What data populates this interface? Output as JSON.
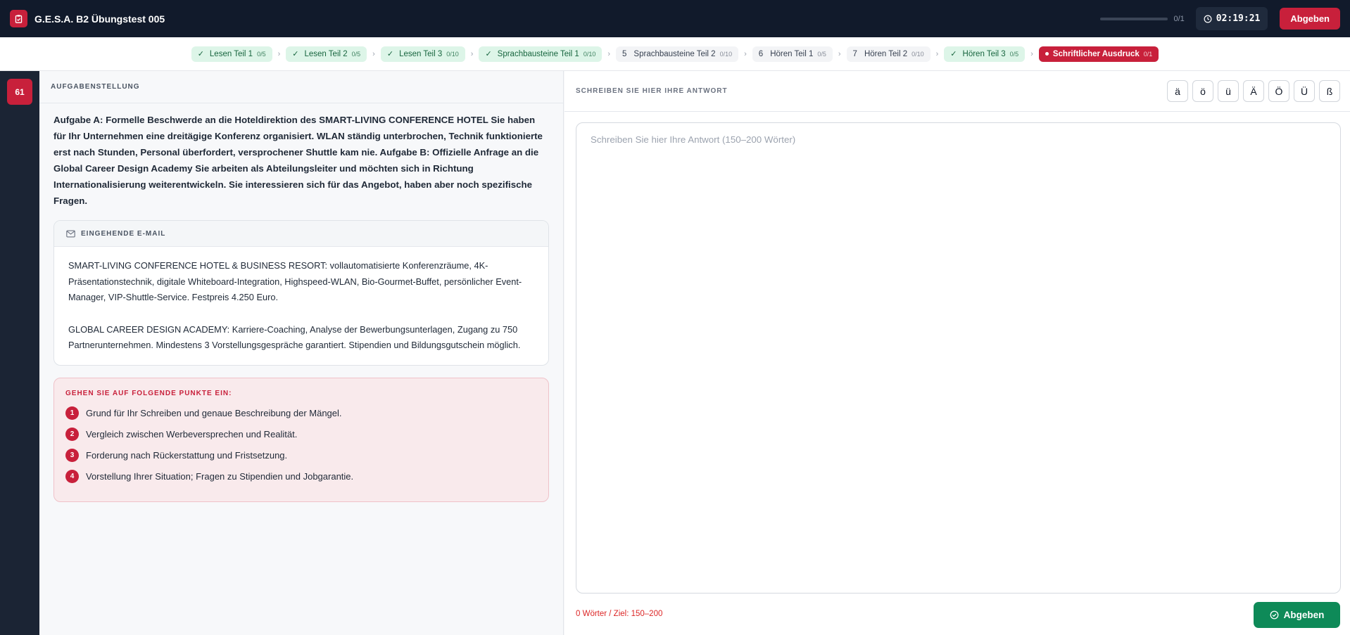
{
  "header": {
    "title": "G.E.S.A. B2 Übungstest 005",
    "progress_count": "0/1",
    "progress_fraction": 0.0,
    "timer": "02:19:21",
    "submit_label": "Abgeben"
  },
  "steps": [
    {
      "label": "Lesen Teil 1",
      "count": "0/5",
      "state": "done"
    },
    {
      "label": "Lesen Teil 2",
      "count": "0/5",
      "state": "done"
    },
    {
      "label": "Lesen Teil 3",
      "count": "0/10",
      "state": "done"
    },
    {
      "label": "Sprachbausteine Teil 1",
      "count": "0/10",
      "state": "done"
    },
    {
      "number": "5",
      "label": "Sprachbausteine Teil 2",
      "count": "0/10",
      "state": "pending"
    },
    {
      "number": "6",
      "label": "Hören Teil 1",
      "count": "0/5",
      "state": "pending"
    },
    {
      "number": "7",
      "label": "Hören Teil 2",
      "count": "0/10",
      "state": "pending"
    },
    {
      "label": "Hören Teil 3",
      "count": "0/5",
      "state": "done"
    },
    {
      "label": "Schriftlicher Ausdruck",
      "count": "0/1",
      "state": "active"
    }
  ],
  "rail": {
    "badge": "61"
  },
  "task": {
    "heading": "AUFGABENSTELLUNG",
    "text": "Aufgabe A: Formelle Beschwerde an die Hoteldirektion des SMART-LIVING CONFERENCE HOTEL Sie haben für Ihr Unternehmen eine dreitägige Konferenz organisiert. WLAN ständig unterbrochen, Technik funktionierte erst nach Stunden, Personal überfordert, versprochener Shuttle kam nie. Aufgabe B: Offizielle Anfrage an die Global Career Design Academy Sie arbeiten als Abteilungsleiter und möchten sich in Richtung Internationalisierung weiterentwickeln. Sie interessieren sich für das Angebot, haben aber noch spezifische Fragen.",
    "mail": {
      "heading": "EINGEHENDE E-MAIL",
      "paragraph_1": "SMART-LIVING CONFERENCE HOTEL & BUSINESS RESORT: vollautomatisierte Konferenzräume, 4K-Präsentationstechnik, digitale Whiteboard-Integration, Highspeed-WLAN, Bio-Gourmet-Buffet, persönlicher Event-Manager, VIP-Shuttle-Service. Festpreis 4.250 Euro.",
      "paragraph_2": "GLOBAL CAREER DESIGN ACADEMY: Karriere-Coaching, Analyse der Bewerbungsunterlagen, Zugang zu 750 Partnerunternehmen. Mindestens 3 Vorstellungsgespräche garantiert. Stipendien und Bildungsgutschein möglich."
    },
    "points": {
      "heading": "GEHEN SIE AUF FOLGENDE PUNKTE EIN:",
      "items": [
        {
          "n": "1",
          "text": "Grund für Ihr Schreiben und genaue Beschreibung der Mängel."
        },
        {
          "n": "2",
          "text": "Vergleich zwischen Werbeversprechen und Realität."
        },
        {
          "n": "3",
          "text": "Forderung nach Rückerstattung und Fristsetzung."
        },
        {
          "n": "4",
          "text": "Vorstellung Ihrer Situation; Fragen zu Stipendien und Jobgarantie."
        }
      ]
    }
  },
  "answer": {
    "heading": "SCHREIBEN SIE HIER IHRE ANTWORT",
    "umlauts": [
      "ä",
      "ö",
      "ü",
      "Ä",
      "Ö",
      "Ü",
      "ß"
    ],
    "placeholder": "Schreiben Sie hier Ihre Antwort (150–200 Wörter)",
    "value": "",
    "word_count": "0 Wörter / Ziel: 150–200",
    "submit_label": "Abgeben"
  },
  "colors": {
    "accent": "#c8203b",
    "success": "#0e8a58",
    "topbar": "#111a2b"
  }
}
